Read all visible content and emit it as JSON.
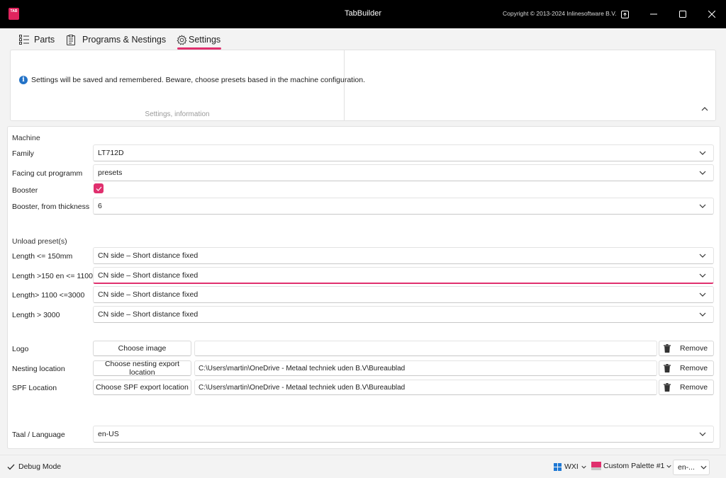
{
  "window": {
    "logo_text": "TAB",
    "title": "TabBuilder",
    "copyright": "Copyright © 2013-2024 Inlinesoftware B.V."
  },
  "tabs": [
    {
      "label": "Parts",
      "icon": "list-icon"
    },
    {
      "label": "Programs & Nestings",
      "icon": "clipboard-icon"
    },
    {
      "label": "Settings",
      "icon": "gear-icon",
      "selected": true
    }
  ],
  "info": {
    "message": "Settings will be saved and remembered. Beware, choose presets based in the machine configuration.",
    "caption": "Settings, information"
  },
  "machine": {
    "section": "Machine",
    "family_label": "Family",
    "family_value": "LT712D",
    "facing_label": "Facing cut programm",
    "facing_value": "presets",
    "booster_label": "Booster",
    "booster_checked": true,
    "booster_thickness_label": "Booster, from thickness",
    "booster_thickness_value": "6"
  },
  "unload": {
    "section": "Unload preset(s)",
    "rows": [
      {
        "label": "Length <= 150mm",
        "value": "CN side – Short distance fixed"
      },
      {
        "label": "Length >150 en <= 1100",
        "value": "CN side – Short distance fixed"
      },
      {
        "label": "Length> 1100  <=3000",
        "value": "CN side – Short distance fixed"
      },
      {
        "label": "Length > 3000",
        "value": "CN side – Short distance fixed"
      }
    ]
  },
  "files": {
    "remove_label": "Remove",
    "rows": [
      {
        "label": "Logo",
        "button": "Choose image",
        "path": ""
      },
      {
        "label": "Nesting location",
        "button": "Choose nesting export location",
        "path": "C:\\Users\\martin\\OneDrive - Metaal techniek uden B.V\\Bureaublad"
      },
      {
        "label": "SPF Location",
        "button": "Choose SPF export location",
        "path": "C:\\Users\\martin\\OneDrive - Metaal techniek uden B.V\\Bureaublad"
      }
    ]
  },
  "language": {
    "label": "Taal / Language",
    "value": "en-US"
  },
  "status": {
    "debug": "Debug Mode",
    "theme": "WXI",
    "palette": "Custom Palette #1",
    "lang": "en-..."
  },
  "colors": {
    "accent": "#e0306e",
    "titlebar": "#000000",
    "info": "#2473c7"
  }
}
